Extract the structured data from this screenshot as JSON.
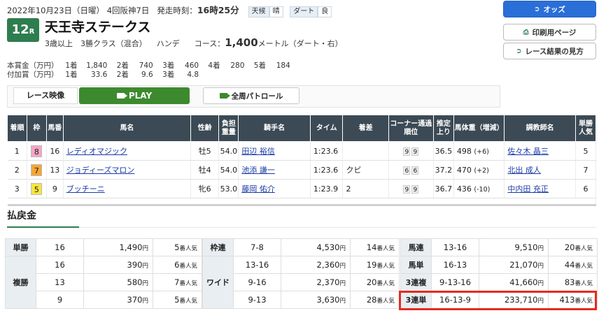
{
  "header": {
    "date": "2022年10月23日（日曜）",
    "meeting": "4回阪神7日",
    "start_label": "発走時刻：",
    "start_time": "16時25分",
    "weather_label": "天候",
    "weather": "晴",
    "track_label": "ダート",
    "track": "良"
  },
  "race": {
    "number": "12",
    "number_suffix": "R",
    "name": "天王寺ステークス",
    "class": "3歳以上　3勝クラス（混合）",
    "handicap": "ハンデ",
    "course_label": "コース：",
    "distance": "1,400",
    "distance_unit": "メートル（ダート・右）"
  },
  "prizes": {
    "main_label": "本賞金（万円）",
    "main": [
      [
        "1着",
        "1,840"
      ],
      [
        "2着",
        "740"
      ],
      [
        "3着",
        "460"
      ],
      [
        "4着",
        "280"
      ],
      [
        "5着",
        "184"
      ]
    ],
    "extra_label": "付加賞（万円）",
    "extra": [
      [
        "1着",
        "33.6"
      ],
      [
        "2着",
        "9.6"
      ],
      [
        "3着",
        "4.8"
      ]
    ]
  },
  "side_buttons": {
    "odds": "オッズ",
    "print": "印刷用ページ",
    "howto": "レース結果の見方"
  },
  "video": {
    "label": "レース映像",
    "play": "PLAY",
    "patrol": "全周パトロール"
  },
  "results": {
    "headers": [
      "着順",
      "枠",
      "馬番",
      "馬名",
      "性齢",
      "負担重量",
      "騎手名",
      "タイム",
      "着差",
      "コーナー通過順位",
      "推定上り",
      "馬体重（増減）",
      "調教師名",
      "単勝人気"
    ],
    "rows": [
      {
        "rank": "1",
        "waku": "8",
        "waku_color": "#f6a6c4",
        "num": "16",
        "horse": "レディオマジック",
        "sexage": "牡5",
        "weight": "54.0",
        "jockey": "田辺 裕信",
        "time": "1:23.6",
        "margin": "",
        "corner1": "9",
        "corner2": "9",
        "last3f": "36.5",
        "bw": "498",
        "bwd": "(+6)",
        "trainer": "佐々木 晶三",
        "pop": "5"
      },
      {
        "rank": "2",
        "waku": "7",
        "waku_color": "#f7a534",
        "num": "13",
        "horse": "ジョディーズマロン",
        "sexage": "牡4",
        "weight": "54.0",
        "jockey": "池添 謙一",
        "time": "1:23.6",
        "margin": "クビ",
        "corner1": "6",
        "corner2": "6",
        "last3f": "37.2",
        "bw": "470",
        "bwd": "(+2)",
        "trainer": "北出 成人",
        "pop": "7"
      },
      {
        "rank": "3",
        "waku": "5",
        "waku_color": "#f8e53d",
        "num": "9",
        "horse": "ブッチーニ",
        "sexage": "牝6",
        "weight": "53.0",
        "jockey": "藤岡 佑介",
        "time": "1:23.9",
        "margin": "2",
        "corner1": "9",
        "corner2": "9",
        "last3f": "36.7",
        "bw": "436",
        "bwd": "(-10)",
        "trainer": "中内田 充正",
        "pop": "6"
      }
    ]
  },
  "payout": {
    "title": "払戻金",
    "yen_unit": "円",
    "pop_unit": "番人気",
    "left": [
      {
        "cat": "単勝",
        "rows": [
          {
            "num": "16",
            "amount": "1,490",
            "pop": "5"
          }
        ]
      },
      {
        "cat": "複勝",
        "rows": [
          {
            "num": "16",
            "amount": "390",
            "pop": "6"
          },
          {
            "num": "13",
            "amount": "580",
            "pop": "7"
          },
          {
            "num": "9",
            "amount": "370",
            "pop": "5"
          }
        ]
      }
    ],
    "middle": [
      {
        "cat": "枠連",
        "rows": [
          {
            "num": "7-8",
            "amount": "4,530",
            "pop": "14"
          }
        ]
      },
      {
        "cat": "ワイド",
        "rows": [
          {
            "num": "13-16",
            "amount": "2,360",
            "pop": "19"
          },
          {
            "num": "9-16",
            "amount": "2,370",
            "pop": "20"
          },
          {
            "num": "9-13",
            "amount": "3,630",
            "pop": "28"
          }
        ]
      }
    ],
    "right": [
      {
        "cat": "馬連",
        "num": "13-16",
        "amount": "9,510",
        "pop": "20"
      },
      {
        "cat": "馬単",
        "num": "16-13",
        "amount": "21,070",
        "pop": "44"
      },
      {
        "cat": "3連複",
        "num": "9-13-16",
        "amount": "41,660",
        "pop": "83"
      },
      {
        "cat": "3連単",
        "num": "16-13-9",
        "amount": "233,710",
        "pop": "413"
      }
    ]
  }
}
